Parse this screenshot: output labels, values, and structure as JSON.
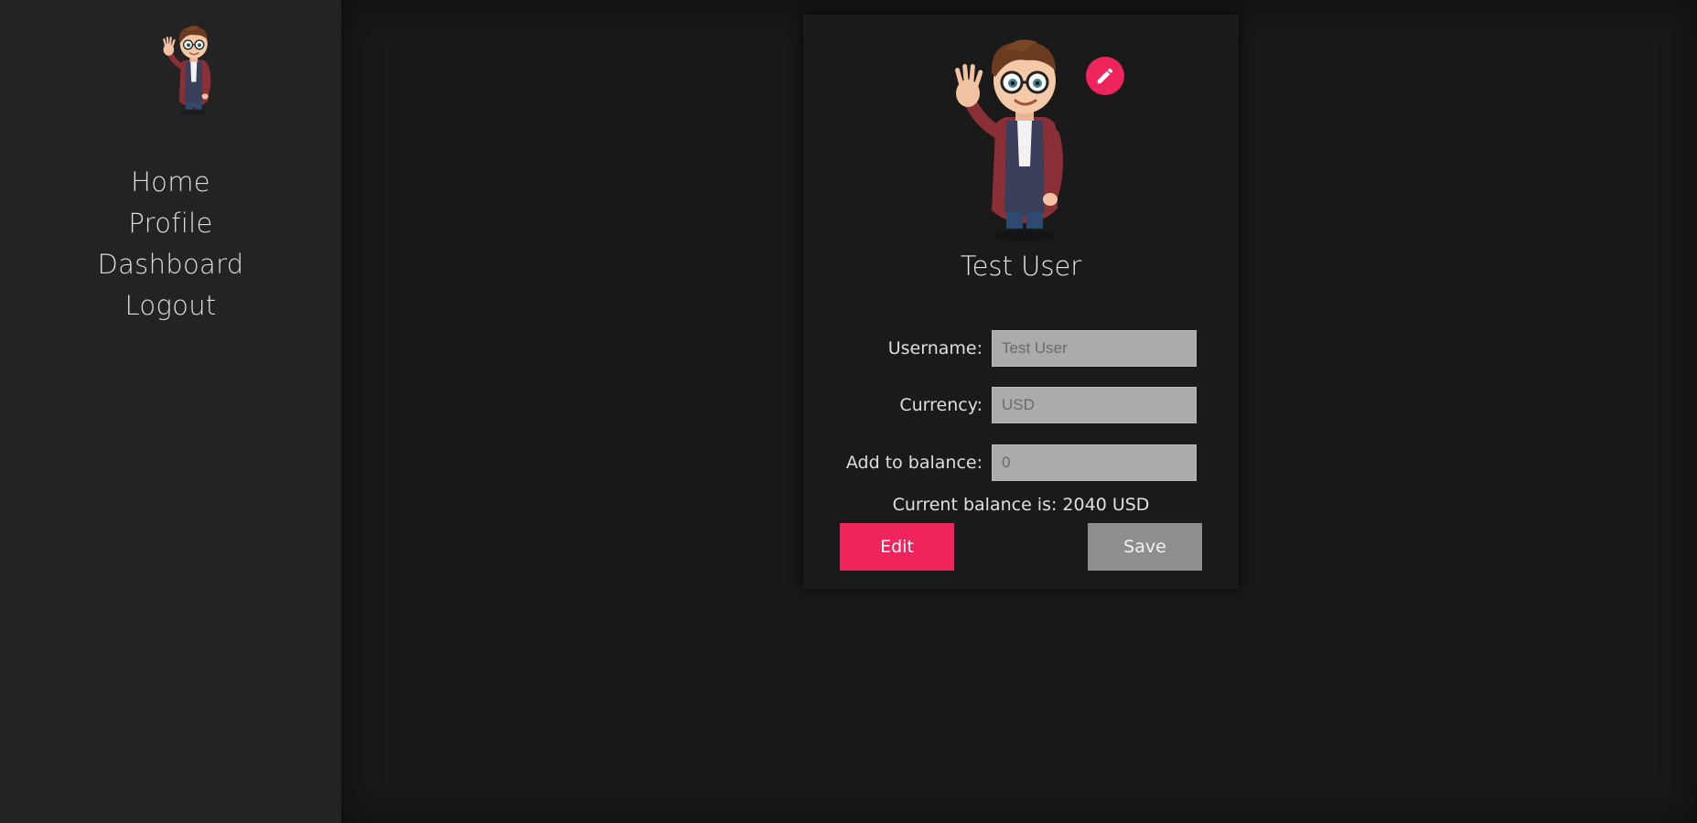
{
  "nav": {
    "items": [
      {
        "label": "Home"
      },
      {
        "label": "Profile"
      },
      {
        "label": "Dashboard"
      },
      {
        "label": "Logout"
      }
    ]
  },
  "profile": {
    "display_name": "Test User",
    "edit_avatar_icon": "pencil-icon",
    "fields": {
      "username": {
        "label": "Username:",
        "placeholder": "Test User"
      },
      "currency": {
        "label": "Currency:",
        "placeholder": "USD"
      },
      "balance": {
        "label": "Add to balance:",
        "placeholder": "0"
      }
    },
    "balance_text": "Current balance is: 2040 USD",
    "edit_label": "Edit",
    "save_label": "Save"
  },
  "colors": {
    "accent": "#f0245c",
    "sidebar_bg": "#232323",
    "main_bg": "#181818",
    "input_bg": "#ababab",
    "save_bg": "#8e8e8e"
  }
}
